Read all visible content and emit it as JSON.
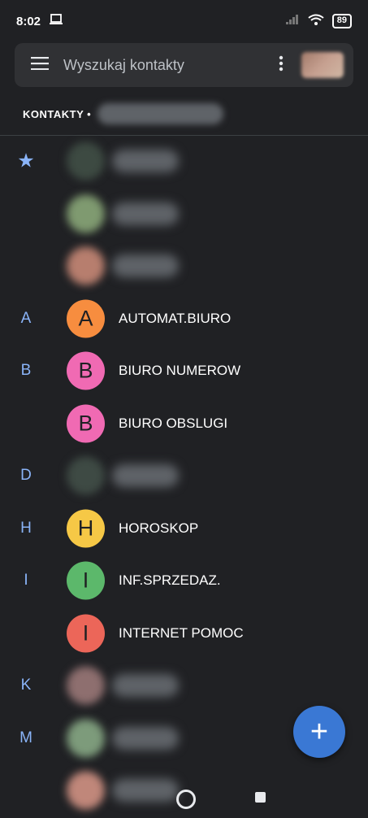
{
  "status_bar": {
    "time": "8:02",
    "battery": "89",
    "icons": [
      "laptop-icon",
      "signal-icon",
      "wifi-icon",
      "battery-icon"
    ]
  },
  "search": {
    "placeholder": "Wyszukaj kontakty",
    "icons": [
      "menu-icon",
      "more-vert-icon",
      "account-avatar"
    ]
  },
  "account": {
    "label": "KONTAKTY •"
  },
  "contacts": [
    {
      "letter": "★",
      "initial": "",
      "name": "",
      "avatar_color": "#3d4a42",
      "photo": true,
      "blurred": true
    },
    {
      "letter": "",
      "initial": "",
      "name": "",
      "avatar_color": "#7f9a70",
      "photo": true,
      "blurred": true
    },
    {
      "letter": "",
      "initial": "",
      "name": "",
      "avatar_color": "#b77e6e",
      "photo": true,
      "blurred": true
    },
    {
      "letter": "A",
      "initial": "A",
      "name": "AUTOMAT.BIURO",
      "avatar_color": "#f78d3f",
      "photo": false,
      "blurred": false
    },
    {
      "letter": "B",
      "initial": "B",
      "name": "BIURO NUMEROW",
      "avatar_color": "#f06ab3",
      "photo": false,
      "blurred": false
    },
    {
      "letter": "",
      "initial": "B",
      "name": "BIURO OBSLUGI",
      "avatar_color": "#f06ab3",
      "photo": false,
      "blurred": false
    },
    {
      "letter": "D",
      "initial": "",
      "name": "",
      "avatar_color": "#3e4a44",
      "photo": true,
      "blurred": true
    },
    {
      "letter": "H",
      "initial": "H",
      "name": "HOROSKOP",
      "avatar_color": "#f6c846",
      "photo": false,
      "blurred": false
    },
    {
      "letter": "I",
      "initial": "I",
      "name": "INF.SPRZEDAZ.",
      "avatar_color": "#5cb86b",
      "photo": false,
      "blurred": false
    },
    {
      "letter": "",
      "initial": "I",
      "name": "INTERNET POMOC",
      "avatar_color": "#ec6659",
      "photo": false,
      "blurred": false
    },
    {
      "letter": "K",
      "initial": "",
      "name": "",
      "avatar_color": "#8e6f6f",
      "photo": true,
      "blurred": true
    },
    {
      "letter": "M",
      "initial": "",
      "name": "",
      "avatar_color": "#7d9b7b",
      "photo": true,
      "blurred": true
    },
    {
      "letter": "",
      "initial": "",
      "name": "",
      "avatar_color": "#c0877a",
      "photo": true,
      "blurred": true
    }
  ],
  "fab": {
    "label": "+",
    "icon": "add-icon",
    "color": "#3a78d4"
  },
  "colors": {
    "background": "#202124",
    "accent_letter": "#8ab4f8",
    "searchbar": "#303134"
  }
}
